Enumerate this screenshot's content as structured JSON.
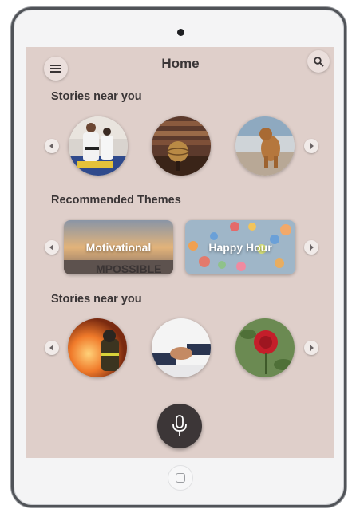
{
  "header": {
    "title": "Home",
    "menu_icon": "menu-icon",
    "search_icon": "search-icon"
  },
  "sections": {
    "stories_near_1": {
      "title": "Stories near you",
      "items": [
        "judo-photo",
        "library-globe-photo",
        "dog-photo"
      ]
    },
    "themes": {
      "title": "Recommended Themes",
      "cards": [
        {
          "label": "Motivational",
          "overlay_text": "MPOSSIBLE"
        },
        {
          "label": "Happy Hour"
        }
      ]
    },
    "stories_near_2": {
      "title": "Stories near you",
      "items": [
        "firefighter-photo",
        "handshake-photo",
        "rose-photo"
      ]
    }
  },
  "footer": {
    "mic_icon": "microphone-icon"
  },
  "colors": {
    "background": "#dfcfca",
    "text": "#3a3536",
    "mic": "#3c3637"
  }
}
